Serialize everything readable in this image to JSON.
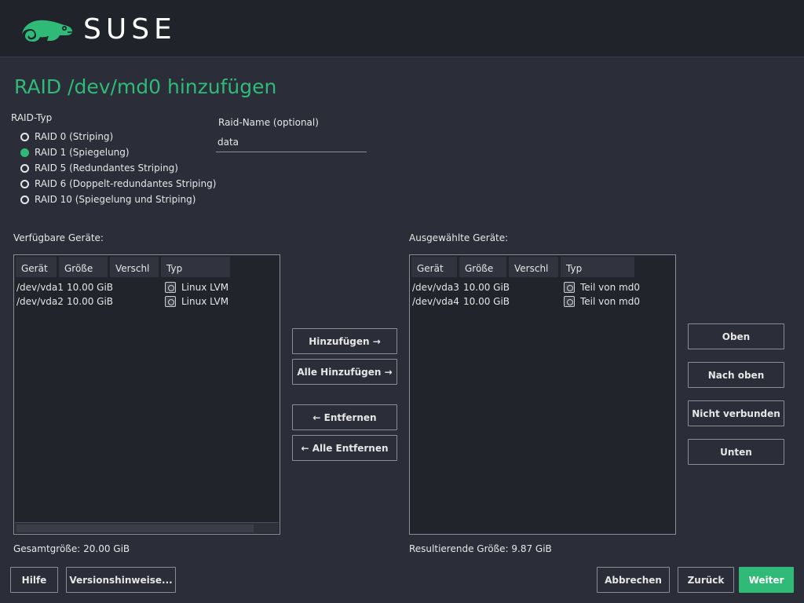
{
  "header": {
    "logo_text": "SUSE"
  },
  "title": "RAID /dev/md0 hinzufügen",
  "raid_type": {
    "label": "RAID-Typ",
    "options": [
      {
        "label": "RAID 0  (Striping)",
        "checked": false
      },
      {
        "label": "RAID 1  (Spiegelung)",
        "checked": true
      },
      {
        "label": "RAID 5  (Redundantes Striping)",
        "checked": false
      },
      {
        "label": "RAID 6  (Doppelt-redundantes Striping)",
        "checked": false
      },
      {
        "label": "RAID 10  (Spiegelung und Striping)",
        "checked": false
      }
    ]
  },
  "raid_name": {
    "label": "Raid-Name (optional)",
    "value": "data"
  },
  "available": {
    "label": "Verfügbare Geräte:",
    "columns": [
      "Gerät",
      "Größe",
      "Verschl",
      "Typ"
    ],
    "rows": [
      {
        "device": "/dev/vda1",
        "size": "10.00 GiB",
        "encrypted": "",
        "type": "Linux LVM"
      },
      {
        "device": "/dev/vda2",
        "size": "10.00 GiB",
        "encrypted": "",
        "type": "Linux LVM"
      }
    ],
    "total": "Gesamtgröße: 20.00 GiB"
  },
  "selected": {
    "label": "Ausgewählte Geräte:",
    "columns": [
      "Gerät",
      "Größe",
      "Verschl",
      "Typ"
    ],
    "rows": [
      {
        "device": "/dev/vda3",
        "size": "10.00 GiB",
        "encrypted": "",
        "type": "Teil von md0"
      },
      {
        "device": "/dev/vda4",
        "size": "10.00 GiB",
        "encrypted": "",
        "type": "Teil von md0"
      }
    ],
    "total": "Resultierende Größe: 9.87 GiB"
  },
  "move_buttons": {
    "add": "Hinzufügen →",
    "add_all": "Alle Hinzufügen →",
    "remove": "← Entfernen",
    "remove_all": "← Alle Entfernen"
  },
  "order_buttons": {
    "top": "Oben",
    "up": "Nach oben",
    "unconnected": "Nicht verbunden",
    "bottom": "Unten"
  },
  "footer": {
    "help": "Hilfe",
    "release_notes": "Versionshinweise...",
    "cancel": "Abbrechen",
    "back": "Zurück",
    "next": "Weiter"
  },
  "colors": {
    "accent": "#30ba78",
    "background": "#2b2e38",
    "header": "#21232b"
  }
}
